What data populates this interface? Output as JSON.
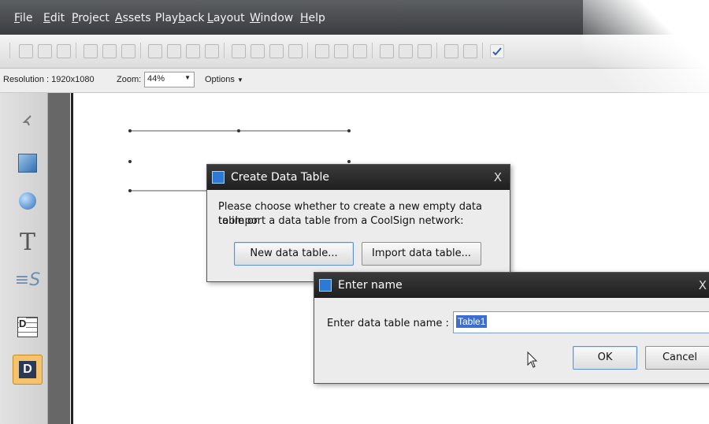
{
  "menubar": {
    "items": [
      "File",
      "Edit",
      "Project",
      "Assets",
      "Playback",
      "Layout",
      "Window",
      "Help"
    ],
    "underline": [
      "F",
      "E",
      "P",
      "A",
      "b",
      "L",
      "W",
      "H"
    ]
  },
  "optionsbar": {
    "resolution_label": "Resolution : 1920x1080",
    "zoom_label": "Zoom:",
    "zoom_value": "44%",
    "options_label": "Options"
  },
  "sidebar": {
    "tools": [
      "pointer-icon",
      "rectangle-tool-icon",
      "ellipse-tool-icon",
      "text-tool-icon",
      "script-text-icon",
      "data-grid-icon",
      "data-tool-icon"
    ],
    "text_tool_glyph": "T",
    "script_glyph": "S",
    "data_glyph": "D"
  },
  "create_dialog": {
    "title": "Create Data Table",
    "close": "X",
    "message_line1": "Please choose whether to create a new empty data table or",
    "message_line2": "to import a data table from a CoolSign network:",
    "new_button": "New data table...",
    "import_button": "Import data table..."
  },
  "enter_dialog": {
    "title": "Enter name",
    "close": "X",
    "field_label": "Enter data table name :",
    "field_value": "Table1",
    "ok_button": "OK",
    "cancel_button": "Cancel"
  }
}
